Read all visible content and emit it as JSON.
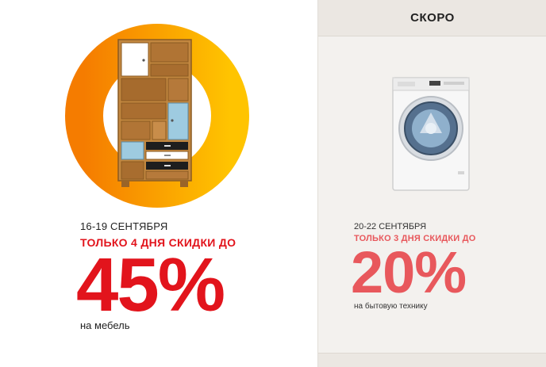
{
  "left_promo": {
    "dates": "16-19 СЕНТЯБРЯ",
    "headline": "ТОЛЬКО 4 ДНЯ СКИДКИ ДО",
    "percent": "45%",
    "caption": "на мебель",
    "accent_color": "#e2141c",
    "ring_colors": [
      "#f57c00",
      "#ffc400"
    ],
    "image_icon": "bookcase-icon"
  },
  "right_promo": {
    "header": "СКОРО",
    "dates": "20-22 СЕНТЯБРЯ",
    "headline": "ТОЛЬКО 3 ДНЯ СКИДКИ ДО",
    "percent": "20%",
    "caption": "на бытовую технику",
    "accent_color": "#e8585c",
    "image_icon": "washing-machine-icon"
  }
}
